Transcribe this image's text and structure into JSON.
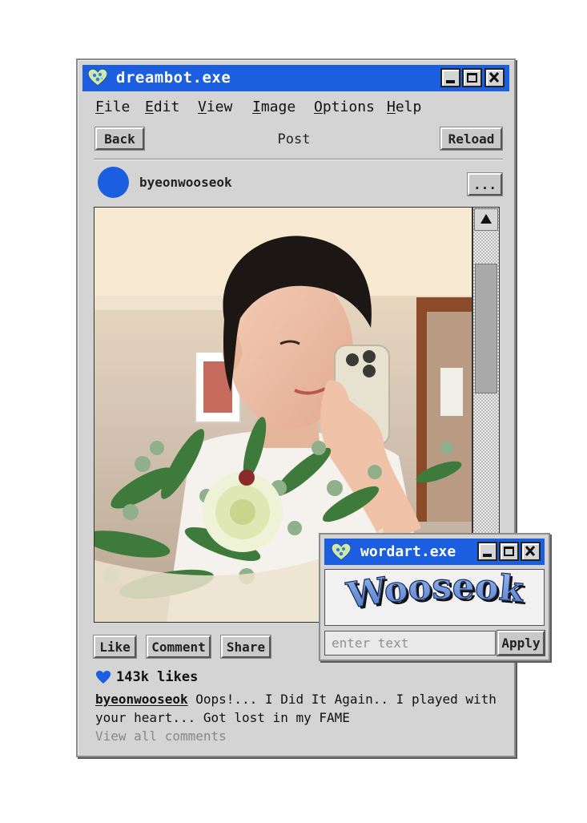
{
  "window": {
    "title": "dreambot.exe"
  },
  "menu": [
    {
      "accel": "F",
      "rest": "ile"
    },
    {
      "accel": "E",
      "rest": "dit"
    },
    {
      "accel": "V",
      "rest": "iew"
    },
    {
      "accel": "I",
      "rest": "mage"
    },
    {
      "accel": "O",
      "rest": "ptions"
    },
    {
      "accel": "H",
      "rest": "elp"
    }
  ],
  "toolbar": {
    "back": "Back",
    "title": "Post",
    "reload": "Reload"
  },
  "post": {
    "username": "byeonwooseok",
    "more": "...",
    "actions": {
      "like": "Like",
      "comment": "Comment",
      "share": "Share"
    },
    "likes": "143k likes",
    "caption_user": "byeonwooseok",
    "caption_text": " Oops!... I Did It Again.. I played with your heart... Got lost in my FAME",
    "view_all": "View all comments"
  },
  "wordart": {
    "title": "wordart.exe",
    "art_text": "Wooseok",
    "input_placeholder": "enter text",
    "apply": "Apply"
  },
  "colors": {
    "accent": "#1b5fe0",
    "window": "#d4d4d4",
    "heart": "#1b5fe0"
  }
}
